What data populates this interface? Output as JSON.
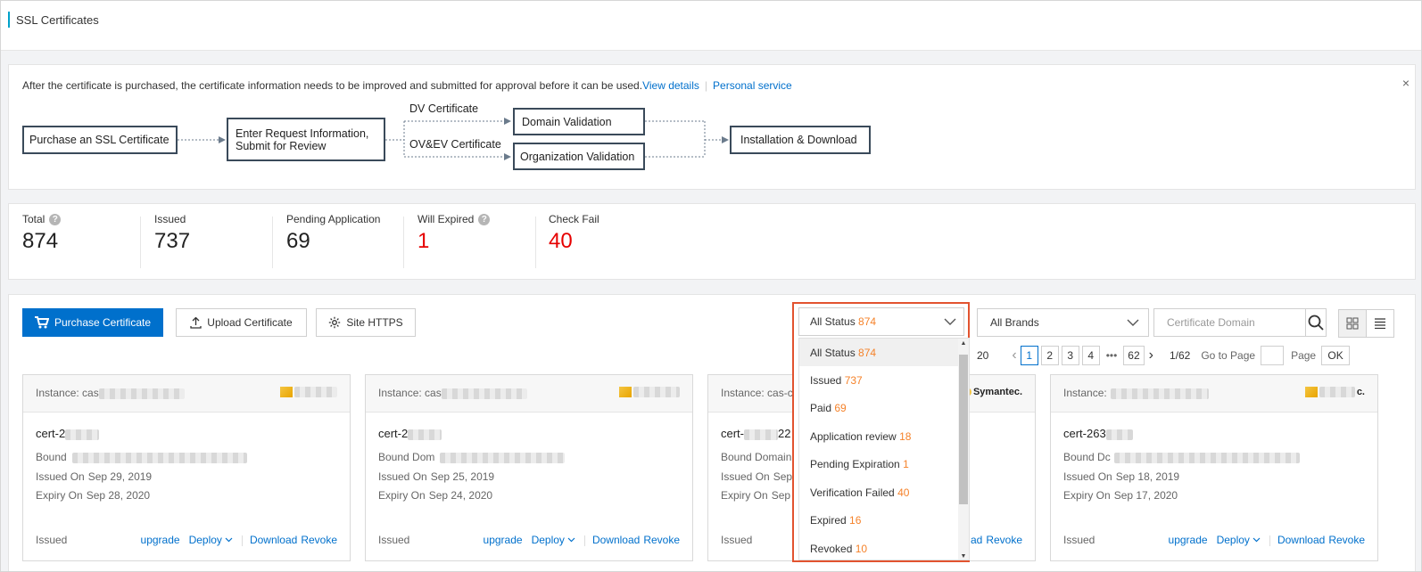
{
  "page": {
    "title": "SSL Certificates"
  },
  "notice": {
    "message": "After the certificate is purchased, the certificate information needs to be improved and submitted for approval before it can be used.",
    "view_details": "View details",
    "personal_service": "Personal service",
    "close": "×"
  },
  "flow": {
    "purchase": "Purchase an SSL Certificate",
    "request_line1": "Enter Request Information,",
    "request_line2": "Submit for Review",
    "dv_label": "DV Certificate",
    "ovev_label": "OV&EV Certificate",
    "domain_validation": "Domain Validation",
    "org_validation": "Organization Validation",
    "install": "Installation & Download"
  },
  "stats": {
    "total": {
      "label": "Total",
      "value": "874"
    },
    "issued": {
      "label": "Issued",
      "value": "737"
    },
    "pending": {
      "label": "Pending Application",
      "value": "69"
    },
    "will_expired": {
      "label": "Will Expired",
      "value": "1"
    },
    "check_fail": {
      "label": "Check Fail",
      "value": "40"
    }
  },
  "toolbar": {
    "purchase": "Purchase Certificate",
    "upload": "Upload Certificate",
    "site_https": "Site HTTPS",
    "brands": "All Brands",
    "search_placeholder": "Certificate Domain"
  },
  "status_filter": {
    "selected_label": "All Status",
    "selected_count": "874",
    "options": [
      {
        "label": "All Status",
        "count": "874"
      },
      {
        "label": "Issued",
        "count": "737"
      },
      {
        "label": "Paid",
        "count": "69"
      },
      {
        "label": "Application review",
        "count": "18"
      },
      {
        "label": "Pending Expiration",
        "count": "1"
      },
      {
        "label": "Verification Failed",
        "count": "40"
      },
      {
        "label": "Expired",
        "count": "16"
      },
      {
        "label": "Revoked",
        "count": "10"
      }
    ]
  },
  "pagination": {
    "count_suffix": "20",
    "pages": [
      "1",
      "2",
      "3",
      "4"
    ],
    "ellipsis": "•••",
    "last": "62",
    "position": "1/62",
    "goto": "Go to Page",
    "page": "Page",
    "ok": "OK"
  },
  "cards": [
    {
      "instance": "Instance: cas",
      "brand": "",
      "name": "cert-2",
      "bound": "Bound",
      "issued_label": "Issued On",
      "issued": "Sep 29, 2019",
      "expiry_label": "Expiry On",
      "expiry": "Sep 28, 2020",
      "status": "Issued"
    },
    {
      "instance": "Instance: cas",
      "brand": "",
      "name": "cert-2",
      "bound": "Bound Dom",
      "issued_label": "Issued On",
      "issued": "Sep 25, 2019",
      "expiry_label": "Expiry On",
      "expiry": "Sep 24, 2020",
      "status": "Issued"
    },
    {
      "instance": "Instance: cas-cr",
      "brand": "Symantec.",
      "name": "cert-",
      "name_tail": "22",
      "bound": "Bound Domain",
      "issued_label": "Issued On",
      "issued": "Sep",
      "expiry_label": "Expiry On",
      "expiry": "Sep 2",
      "status": "Issued"
    },
    {
      "instance": "Instance:",
      "brand": "c.",
      "name": "cert-263",
      "bound": "Bound Dc",
      "issued_label": "Issued On",
      "issued": "Sep 18, 2019",
      "expiry_label": "Expiry On",
      "expiry": "Sep 17, 2020",
      "status": "Issued"
    }
  ],
  "card_actions": {
    "upgrade": "upgrade",
    "deploy": "Deploy",
    "download": "Download",
    "revoke": "Revoke",
    "partial_download": "ad"
  },
  "colors": {
    "accent": "#0070cc",
    "count_orange": "#f5822a",
    "alert_red": "#e60000",
    "highlight_border": "#e2532f"
  }
}
